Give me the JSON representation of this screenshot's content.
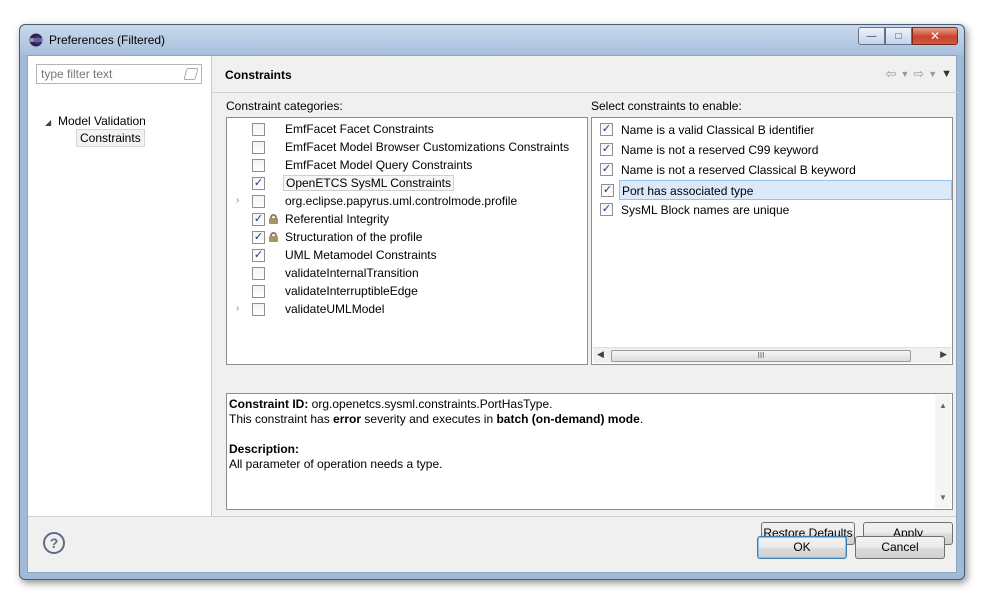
{
  "window": {
    "title": "Preferences (Filtered)",
    "minimize": "—",
    "maximize": "□",
    "close": "✕"
  },
  "filter": {
    "placeholder": "type filter text"
  },
  "tree": {
    "root": "Model Validation",
    "child": "Constraints"
  },
  "page": {
    "title": "Constraints"
  },
  "nav_icons": [
    "back-icon",
    "back-menu-icon",
    "forward-icon",
    "forward-menu-icon",
    "view-menu-icon"
  ],
  "categories": {
    "label": "Constraint categories:",
    "items": [
      {
        "label": "EmfFacet Facet Constraints",
        "checked": false,
        "locked": false,
        "expandable": false
      },
      {
        "label": "EmfFacet Model Browser Customizations Constraints",
        "checked": false,
        "locked": false,
        "expandable": false
      },
      {
        "label": "EmfFacet Model Query Constraints",
        "checked": false,
        "locked": false,
        "expandable": false
      },
      {
        "label": "OpenETCS SysML Constraints",
        "checked": true,
        "locked": false,
        "expandable": false,
        "selected": true
      },
      {
        "label": "org.eclipse.papyrus.uml.controlmode.profile",
        "checked": false,
        "locked": false,
        "expandable": true
      },
      {
        "label": "Referential Integrity",
        "checked": true,
        "locked": true,
        "expandable": false
      },
      {
        "label": "Structuration of the profile",
        "checked": true,
        "locked": true,
        "expandable": false
      },
      {
        "label": "UML Metamodel Constraints",
        "checked": true,
        "locked": false,
        "expandable": false
      },
      {
        "label": "validateInternalTransition",
        "checked": false,
        "locked": false,
        "expandable": false
      },
      {
        "label": "validateInterruptibleEdge",
        "checked": false,
        "locked": false,
        "expandable": false
      },
      {
        "label": "validateUMLModel",
        "checked": false,
        "locked": false,
        "expandable": true
      }
    ]
  },
  "constraints": {
    "label": "Select constraints to enable:",
    "items": [
      {
        "label": "Name is a valid Classical B identifier",
        "checked": true
      },
      {
        "label": "Name is not a reserved C99 keyword",
        "checked": true
      },
      {
        "label": "Name is not a reserved Classical B keyword",
        "checked": true
      },
      {
        "label": "Port has associated type",
        "checked": true,
        "selected": true
      },
      {
        "label": "SysML Block names are unique",
        "checked": true
      }
    ],
    "scroll_thumb": "III"
  },
  "details": {
    "id_label": "Constraint ID:",
    "id_value": " org.openetcs.sysml.constraints.PortHasType.",
    "line2_a": "This constraint has ",
    "line2_b": "error",
    "line2_c": " severity and executes in ",
    "line2_d": "batch (on-demand) mode",
    "line2_e": ".",
    "desc_label": "Description:",
    "desc_text": "All parameter of operation needs a type."
  },
  "buttons": {
    "restore": "Restore Defaults",
    "apply": "Apply",
    "ok": "OK",
    "cancel": "Cancel",
    "help": "?"
  },
  "colors": {
    "selection": "#dbe9fb",
    "check": "#1d3a72",
    "title_bar": "#a7bfdc"
  }
}
